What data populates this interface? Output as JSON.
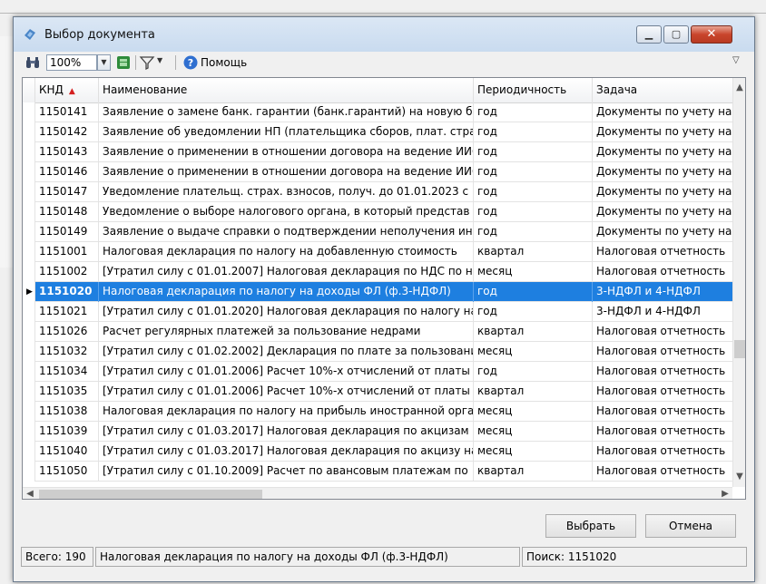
{
  "window": {
    "title": "Выбор документа"
  },
  "toolbar": {
    "zoom_value": "100%",
    "help_label": "Помощь"
  },
  "table": {
    "columns": [
      "КНД",
      "Наименование",
      "Периодичность",
      "Задача"
    ],
    "sort_column": "КНД",
    "rows": [
      [
        "1150141",
        "Заявление о замене банк. гарантии (банк.гарантий) на новую ба",
        "год",
        "Документы по учету на"
      ],
      [
        "1150142",
        "Заявление об уведомлении НП (плательщика сборов, плат. стра",
        "год",
        "Документы по учету на"
      ],
      [
        "1150143",
        "Заявление о применении в отношении договора на ведение ИИС",
        "год",
        "Документы по учету на"
      ],
      [
        "1150146",
        "Заявление о применении в отношении договора на ведение ИИС",
        "год",
        "Документы по учету на"
      ],
      [
        "1150147",
        "Уведомление плательщ. страх. взносов, получ. до 01.01.2023 с",
        "год",
        "Документы по учету на"
      ],
      [
        "1150148",
        "Уведомление о выборе налогового органа, в который представ",
        "год",
        "Документы по учету на"
      ],
      [
        "1150149",
        "Заявление о выдаче справки о подтверждении неполучения ине",
        "год",
        "Документы по учету на"
      ],
      [
        "1151001",
        "Налоговая декларация по налогу на добавленную стоимость",
        "квартал",
        "Налоговая отчетность"
      ],
      [
        "1151002",
        "[Утратил силу с 01.01.2007] Налоговая декларация по НДС по н",
        "месяц",
        "Налоговая отчетность"
      ],
      [
        "1151020",
        "Налоговая декларация по налогу на доходы ФЛ (ф.3-НДФЛ)",
        "год",
        "3-НДФЛ и 4-НДФЛ"
      ],
      [
        "1151021",
        "[Утратил силу с 01.01.2020] Налоговая декларация по налогу на",
        "год",
        "3-НДФЛ и 4-НДФЛ"
      ],
      [
        "1151026",
        "Расчет регулярных платежей за пользование недрами",
        "квартал",
        "Налоговая отчетность"
      ],
      [
        "1151032",
        "[Утратил силу с 01.02.2002] Декларация по плате за пользовани",
        "месяц",
        "Налоговая отчетность"
      ],
      [
        "1151034",
        "[Утратил силу с 01.01.2006] Расчет 10%-х отчислений от платы з",
        "год",
        "Налоговая отчетность"
      ],
      [
        "1151035",
        "[Утратил силу с 01.01.2006] Расчет 10%-х отчислений от платы з",
        "квартал",
        "Налоговая отчетность"
      ],
      [
        "1151038",
        "Налоговая декларация по налогу на прибыль иностранной орга",
        "месяц",
        "Налоговая отчетность"
      ],
      [
        "1151039",
        "[Утратил силу с 01.03.2017] Налоговая декларация по акцизам",
        "месяц",
        "Налоговая отчетность"
      ],
      [
        "1151040",
        "[Утратил силу с 01.03.2017] Налоговая декларация по акцизу на",
        "месяц",
        "Налоговая отчетность"
      ],
      [
        "1151050",
        "[Утратил силу с 01.10.2009] Расчет по авансовым платежам по",
        "квартал",
        "Налоговая отчетность"
      ]
    ],
    "selected_index": 9
  },
  "buttons": {
    "select": "Выбрать",
    "cancel": "Отмена"
  },
  "status": {
    "total": "Всего: 190",
    "current": "Налоговая декларация по налогу на доходы ФЛ (ф.3-НДФЛ)",
    "search": "Поиск: 1151020"
  },
  "colors": {
    "selection": "#1e7fe0",
    "close_button": "#c9452c",
    "sort_arrow": "#d42020"
  }
}
